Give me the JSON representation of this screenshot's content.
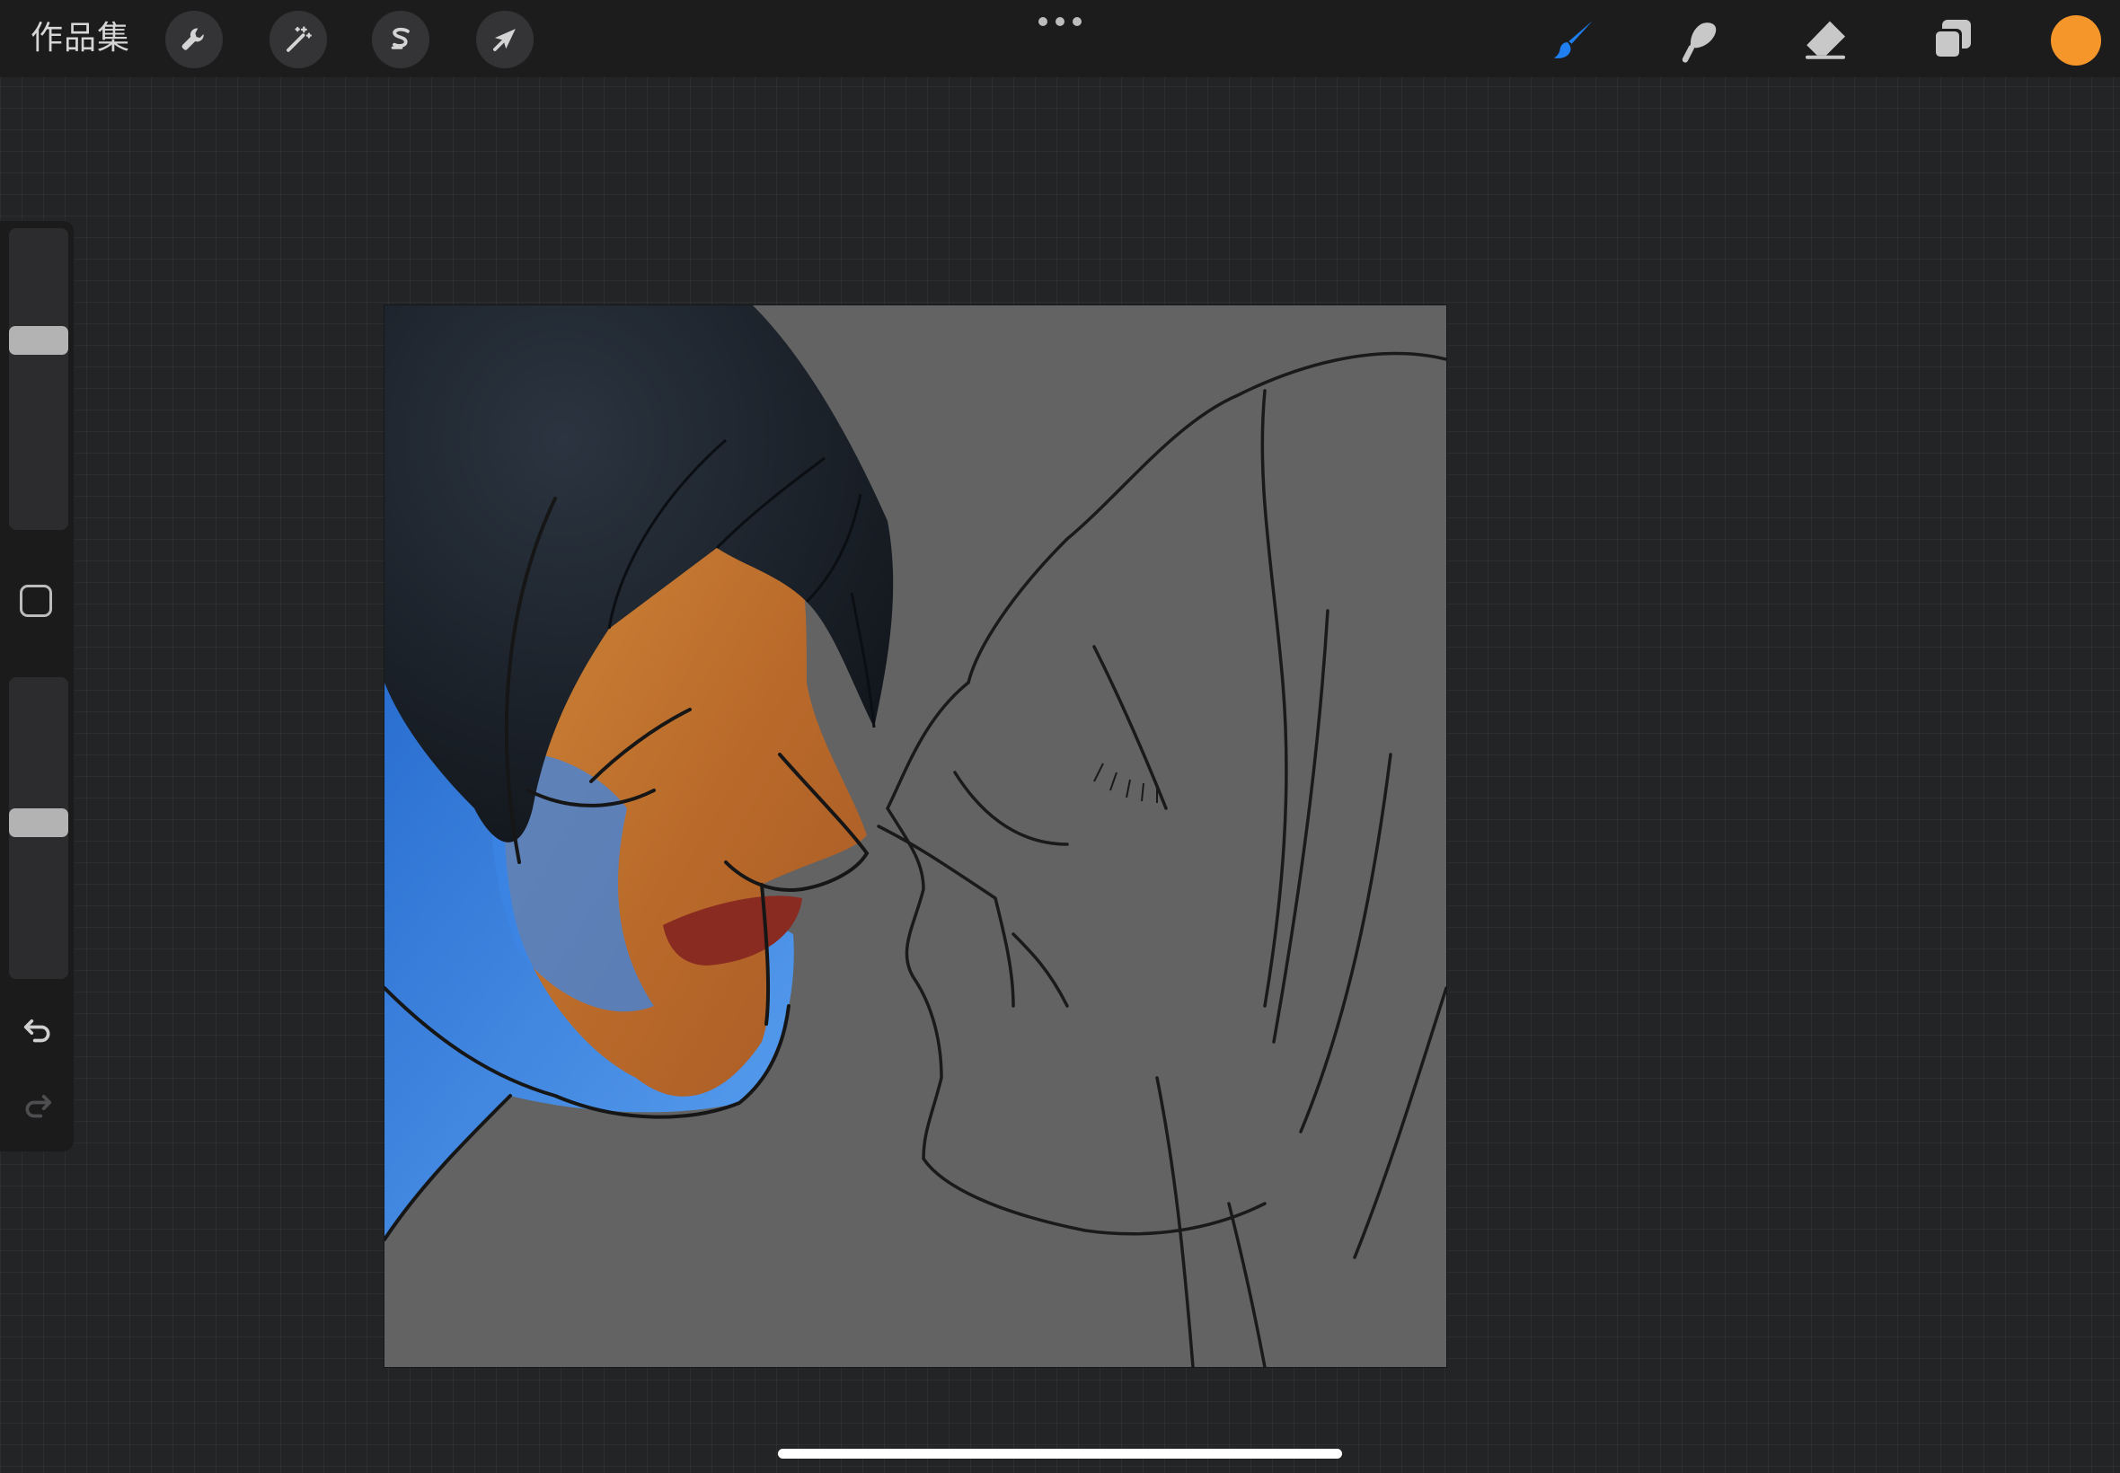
{
  "toolbar": {
    "gallery_label": "作品集",
    "left_tools": [
      {
        "name": "actions",
        "icon": "wrench-icon"
      },
      {
        "name": "adjustments",
        "icon": "magic-wand-icon"
      },
      {
        "name": "selection",
        "icon": "selection-s-icon"
      },
      {
        "name": "transform",
        "icon": "arrow-cursor-icon"
      }
    ],
    "more_icon": "more-dots-icon",
    "right_tools": [
      {
        "name": "brush",
        "icon": "brush-icon",
        "active": true
      },
      {
        "name": "smudge",
        "icon": "smudge-icon",
        "active": false
      },
      {
        "name": "eraser",
        "icon": "eraser-icon",
        "active": false
      },
      {
        "name": "layers",
        "icon": "layers-icon",
        "active": false
      }
    ],
    "current_color": "#f5962b"
  },
  "sidebar": {
    "brush_size_slider": {
      "value": 0.64,
      "icon": "slider-thumb"
    },
    "modify_button_icon": "square-outline-icon",
    "opacity_slider": {
      "value": 0.52,
      "icon": "slider-thumb"
    },
    "undo_icon": "undo-arrow-icon",
    "redo_icon": "redo-arrow-icon"
  },
  "colors": {
    "toolbar_bg": "#1c1c1d",
    "active_tool": "#1f7ff0",
    "inactive_tool": "#c8c8c8",
    "canvas_bg": "#636363"
  }
}
